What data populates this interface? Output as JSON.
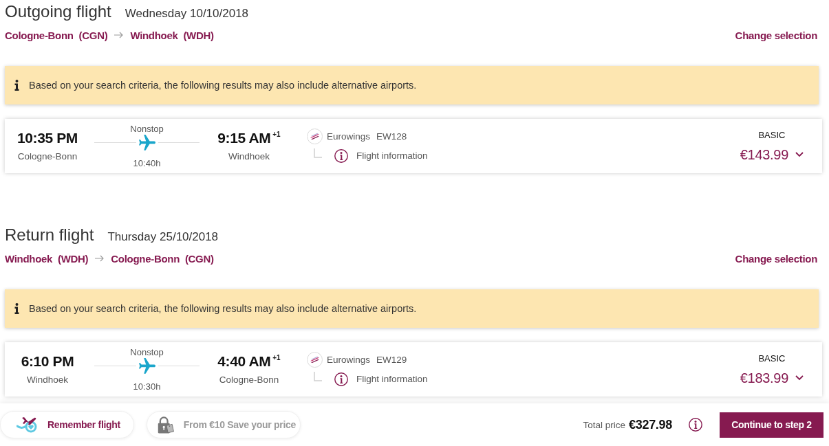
{
  "sections": [
    {
      "title": "Outgoing flight",
      "date": "Wednesday 10/10/2018",
      "route": {
        "from": "Cologne-Bonn (CGN)",
        "to": "Windhoek (WDH)"
      },
      "change_link": "Change selection",
      "notice": "Based on your search criteria, the following results may also include alternative airports.",
      "flight": {
        "departure": {
          "time": "10:35 PM",
          "city": "Cologne-Bonn"
        },
        "stops": "Nonstop",
        "duration": "10:40h",
        "arrival": {
          "time": "9:15 AM",
          "day_offset": "+1",
          "city": "Windhoek"
        },
        "airline": "Eurowings",
        "flight_number": "EW128",
        "info_link": "Flight information",
        "fare": "BASIC",
        "price": "€143.99"
      }
    },
    {
      "title": "Return flight",
      "date": "Thursday 25/10/2018",
      "route": {
        "from": "Windhoek (WDH)",
        "to": "Cologne-Bonn (CGN)"
      },
      "change_link": "Change selection",
      "notice": "Based on your search criteria, the following results may also include alternative airports.",
      "flight": {
        "departure": {
          "time": "6:10 PM",
          "city": "Windhoek"
        },
        "stops": "Nonstop",
        "duration": "10:30h",
        "arrival": {
          "time": "4:40 AM",
          "day_offset": "+1",
          "city": "Cologne-Bonn"
        },
        "airline": "Eurowings",
        "flight_number": "EW129",
        "info_link": "Flight information",
        "fare": "BASIC",
        "price": "€183.99"
      }
    }
  ],
  "footer": {
    "remember_button": "Remember flight",
    "save_price": {
      "label": "From €10 Save your price",
      "disabled": true
    },
    "total": {
      "label": "Total price",
      "amount": "€327.98"
    },
    "continue_button": "Continue to step 2"
  }
}
